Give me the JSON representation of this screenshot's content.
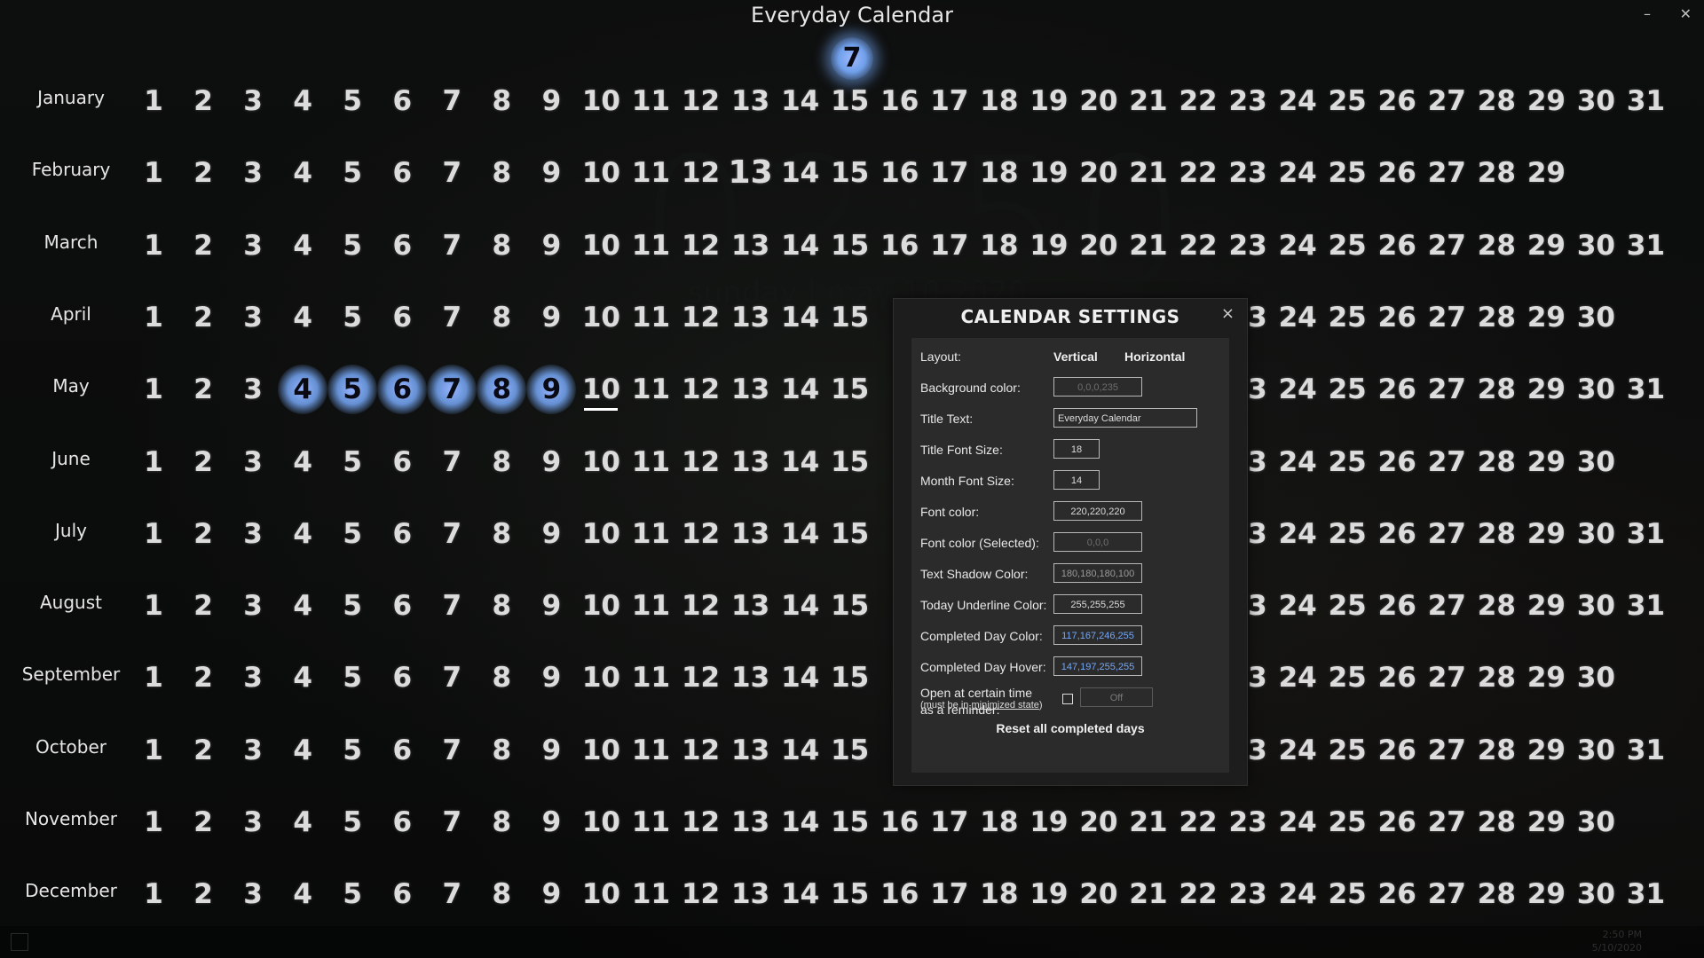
{
  "app": {
    "title": "Everyday Calendar",
    "today_badge": "7",
    "ghost_clock": "02:50",
    "ghost_date": "sunday | may 10 2020"
  },
  "window_controls": {
    "minimize": "–",
    "close": "✕"
  },
  "colors": {
    "background": "#0b0c0c",
    "font": "rgb(220,220,220)",
    "completed": "rgb(117,167,246)",
    "completed_hover": "rgb(147,197,255)",
    "underline": "#ffffff"
  },
  "calendar": {
    "months": [
      {
        "name": "January",
        "days": 31
      },
      {
        "name": "February",
        "days": 29
      },
      {
        "name": "March",
        "days": 31
      },
      {
        "name": "April",
        "days": 30
      },
      {
        "name": "May",
        "days": 31
      },
      {
        "name": "June",
        "days": 30
      },
      {
        "name": "July",
        "days": 31
      },
      {
        "name": "August",
        "days": 31
      },
      {
        "name": "September",
        "days": 30
      },
      {
        "name": "October",
        "days": 31
      },
      {
        "name": "November",
        "days": 30
      },
      {
        "name": "December",
        "days": 31
      }
    ],
    "completed": {
      "month": "May",
      "days": [
        4,
        5,
        6,
        7,
        8,
        9
      ]
    },
    "today": {
      "month": "May",
      "day": 10
    },
    "hovered": {
      "month": "February",
      "day": 13
    }
  },
  "settings": {
    "title": "CALENDAR SETTINGS",
    "close_label": "×",
    "layout_label": "Layout:",
    "layout_vertical": "Vertical",
    "layout_horizontal": "Horizontal",
    "background_color_label": "Background color:",
    "background_color_value": "0,0,0,235",
    "title_text_label": "Title Text:",
    "title_text_value": "Everyday Calendar",
    "title_font_size_label": "Title Font Size:",
    "title_font_size_value": "18",
    "month_font_size_label": "Month Font Size:",
    "month_font_size_value": "14",
    "font_color_label": "Font color:",
    "font_color_value": "220,220,220",
    "font_color_selected_label": "Font color (Selected):",
    "font_color_selected_value": "0,0,0",
    "text_shadow_label": "Text Shadow Color:",
    "text_shadow_value": "180,180,180,100",
    "today_underline_label": "Today Underline Color:",
    "today_underline_value": "255,255,255",
    "completed_day_label": "Completed Day Color:",
    "completed_day_value": "117,167,246,255",
    "completed_hover_label": "Completed Day Hover:",
    "completed_hover_value": "147,197,255,255",
    "reminder_label_1": "Open at certain time",
    "reminder_label_2": "as a reminder:",
    "reminder_value": "Off",
    "note_prefix": "(must be in ",
    "note_link": "minimized state",
    "note_suffix": ")",
    "reset_button": "Reset all completed days"
  },
  "taskbar": {
    "time": "2:50 PM",
    "date": "5/10/2020"
  }
}
